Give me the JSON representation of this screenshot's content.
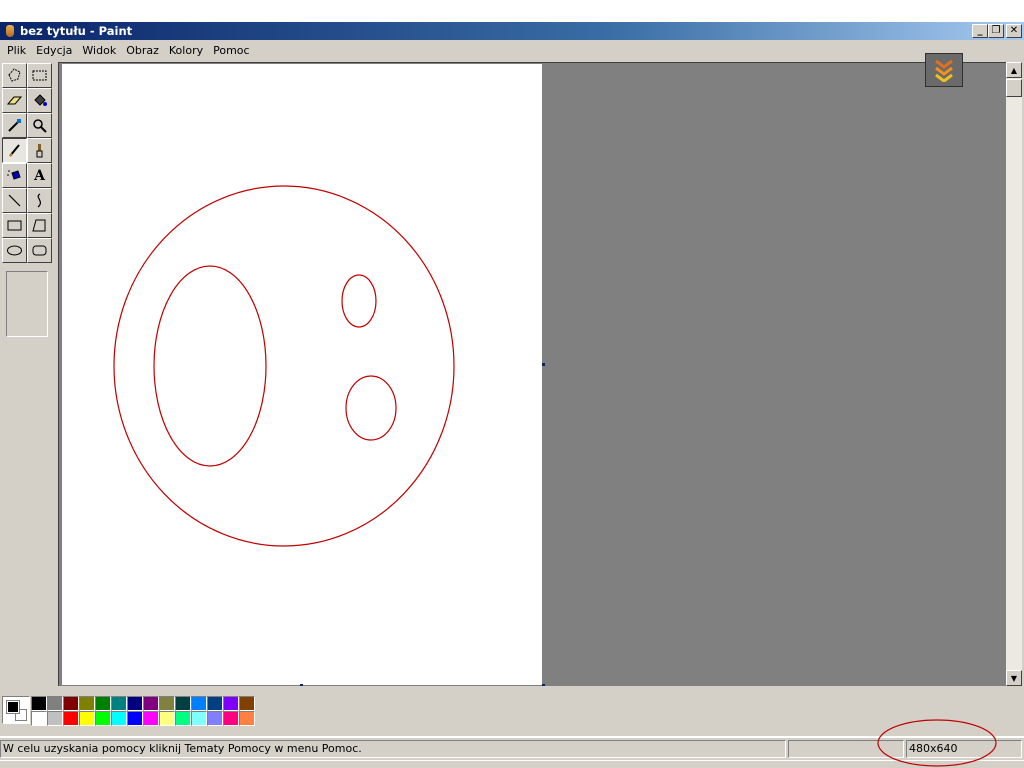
{
  "window": {
    "title": "bez tytułu - Paint",
    "controls": {
      "minimize": "_",
      "restore": "❐",
      "close": "✕"
    }
  },
  "menu": {
    "items": [
      "Plik",
      "Edycja",
      "Widok",
      "Obraz",
      "Kolory",
      "Pomoc"
    ]
  },
  "toolbox": {
    "tools": [
      "free-select-icon",
      "rect-select-icon",
      "eraser-icon",
      "fill-icon",
      "color-picker-icon",
      "magnifier-icon",
      "pencil-icon",
      "brush-icon",
      "airbrush-icon",
      "text-icon",
      "line-icon",
      "curve-icon",
      "rectangle-icon",
      "polygon-icon",
      "ellipse-icon",
      "rounded-rect-icon"
    ],
    "active_tool": "pencil-icon",
    "text_tool_glyph": "A"
  },
  "drawing": {
    "stroke_color": "#c00000"
  },
  "palette": {
    "foreground": "#000000",
    "background": "#ffffff",
    "row1": [
      "#000000",
      "#808080",
      "#800000",
      "#808000",
      "#008000",
      "#008080",
      "#000080",
      "#800080",
      "#808040",
      "#004040",
      "#0080ff",
      "#004080",
      "#8000ff",
      "#804000"
    ],
    "row2": [
      "#ffffff",
      "#c0c0c0",
      "#ff0000",
      "#ffff00",
      "#00ff00",
      "#00ffff",
      "#0000ff",
      "#ff00ff",
      "#ffff80",
      "#00ff80",
      "#80ffff",
      "#8080ff",
      "#ff0080",
      "#ff8040"
    ]
  },
  "status": {
    "help_text": "W celu uzyskania pomocy kliknij Tematy Pomocy w menu Pomoc.",
    "size_text": "480x640"
  }
}
